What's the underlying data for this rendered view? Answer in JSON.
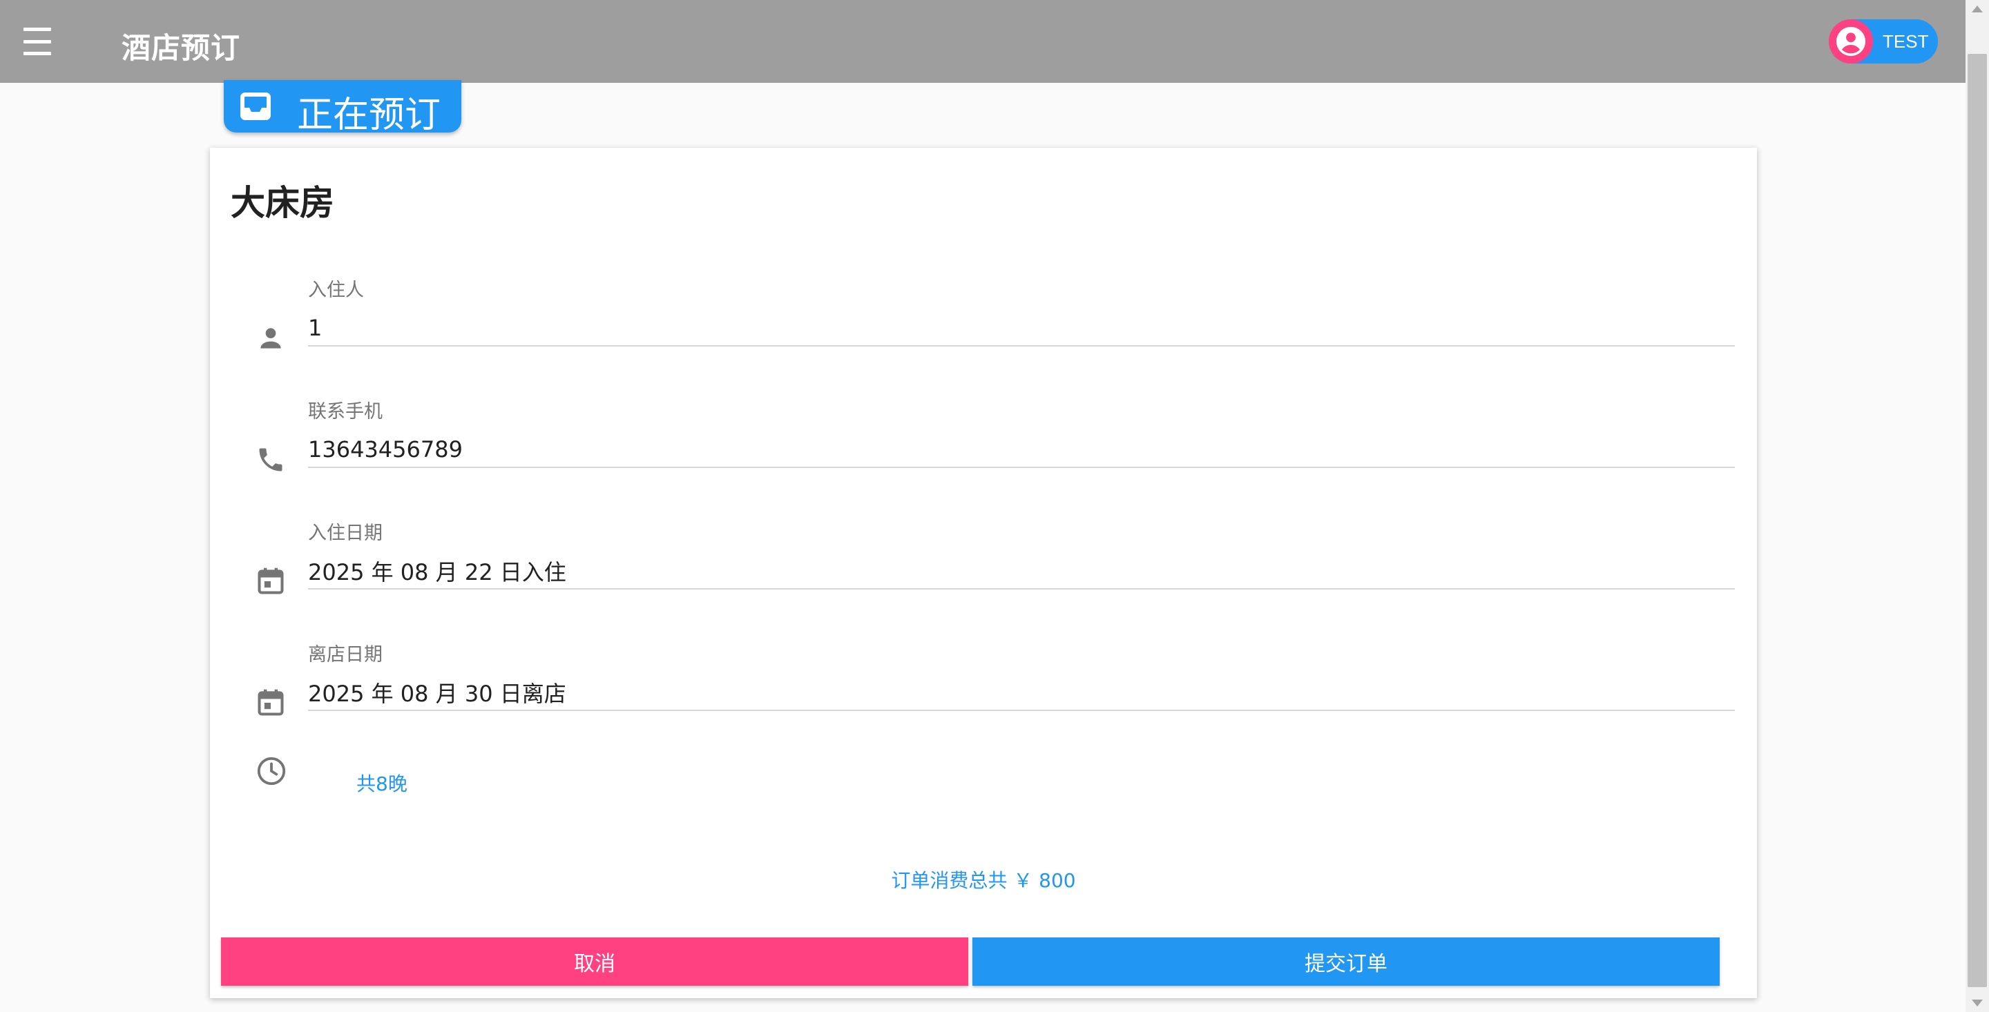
{
  "app": {
    "title": "酒店预订",
    "user_name": "TEST"
  },
  "status_pill": {
    "label": "正在预订"
  },
  "booking": {
    "room_name": "大床房",
    "fields": {
      "guest": {
        "label": "入住人",
        "value": "1"
      },
      "phone": {
        "label": "联系手机",
        "value": "13643456789"
      },
      "checkin": {
        "label": "入住日期",
        "value": "2025 年 08 月 22 日入住"
      },
      "checkout": {
        "label": "离店日期",
        "value": "2025 年 08 月 30 日离店"
      }
    },
    "nights": "共8晚",
    "total": "订单消费总共 ￥ 800",
    "cancel_label": "取消",
    "submit_label": "提交订单"
  },
  "colors": {
    "appbar": "#9e9e9e",
    "primary": "#2196f3",
    "accent": "#ff4081"
  },
  "icons": {
    "menu": "menu-icon",
    "user": "account-circle-icon",
    "pill": "inbox-icon",
    "guest": "person-icon",
    "phone": "phone-icon",
    "checkin": "calendar-icon",
    "checkout": "calendar-icon",
    "nights": "clock-icon"
  }
}
